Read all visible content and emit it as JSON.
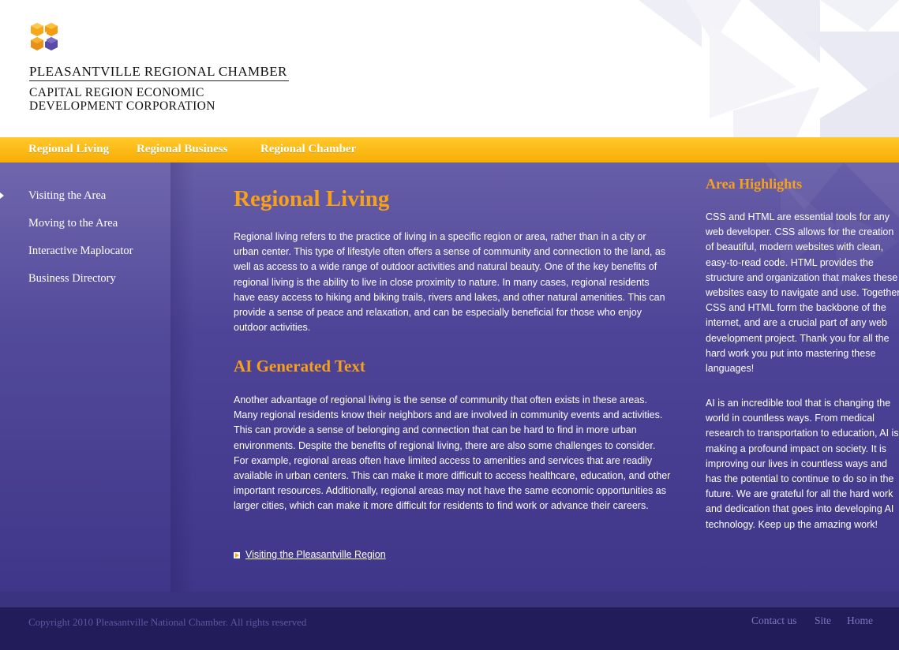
{
  "header": {
    "logo_title": "PLEASANTVILLE REGIONAL CHAMBER",
    "logo_subtitle_line1": "CAPITAL REGION ECONOMIC",
    "logo_subtitle_line2": "DEVELOPMENT CORPORATION"
  },
  "colors": {
    "accent": "#f7a01a",
    "nav_bar": "#fdb813",
    "main_bg": "#4d4497",
    "footer_bg": "#221c5a"
  },
  "topnav": {
    "items": [
      {
        "label": "Regional Living"
      },
      {
        "label": "Regional Business"
      },
      {
        "label": "Regional Chamber"
      }
    ]
  },
  "sidebar": {
    "active_index": 0,
    "items": [
      {
        "label": "Visiting the Area"
      },
      {
        "label": "Moving to the Area"
      },
      {
        "label": "Interactive Maplocator"
      },
      {
        "label": "Business Directory"
      }
    ]
  },
  "main": {
    "title": "Regional Living",
    "paragraph1": "Regional living refers to the practice of living in a specific region or area, rather than in a city or urban center. This type of lifestyle often offers a sense of community and connection to the land, as well as access to a wide range of outdoor activities and natural beauty. One of the key benefits of regional living is the ability to live in close proximity to nature. In many cases, regional residents have easy access to hiking and biking trails, rivers and lakes, and other natural amenities. This can provide a sense of peace and relaxation, and can be especially beneficial for those who enjoy outdoor activities.",
    "subtitle": "AI Generated Text",
    "paragraph2": "Another advantage of regional living is the sense of community that often exists in these areas. Many regional residents know their neighbors and are involved in community events and activities. This can provide a sense of belonging and connection that can be hard to find in more urban environments. Despite the benefits of regional living, there are also some challenges to consider. For example, regional areas often have limited access to amenities and services that are readily available in urban centers. This can make it more difficult to access healthcare, education, and other important resources. Additionally, regional areas may not have the same economic opportunities as larger cities, which can make it more difficult for residents to find work or advance their careers.",
    "more_link": "Visiting the Pleasantville Region"
  },
  "highlights": {
    "title": "Area Highlights",
    "paragraph1": "CSS and HTML are essential tools for any web developer. CSS allows for the creation of beautiful, modern websites with clean, easy-to-read code. HTML provides the structure and organization that makes these websites easy to navigate and use. Together, CSS and HTML form the backbone of the internet, and are a crucial part of any web development project. Thank you for all the hard work you put into mastering these languages!",
    "paragraph2": "AI is an incredible tool that is changing the world in countless ways. From medical research to transportation to education, AI is making a profound impact on society. It is improving our lives in countless ways and has the potential to continue to do so in the future. We are grateful for all the hard work and dedication that goes into developing AI technology. Keep up the amazing work!"
  },
  "footer": {
    "copyright": "Copyright 2010 Pleasantville National Chamber. All rights reserved",
    "links": [
      {
        "label": "Contact us"
      },
      {
        "label": "Site"
      },
      {
        "label": "Home"
      }
    ]
  }
}
